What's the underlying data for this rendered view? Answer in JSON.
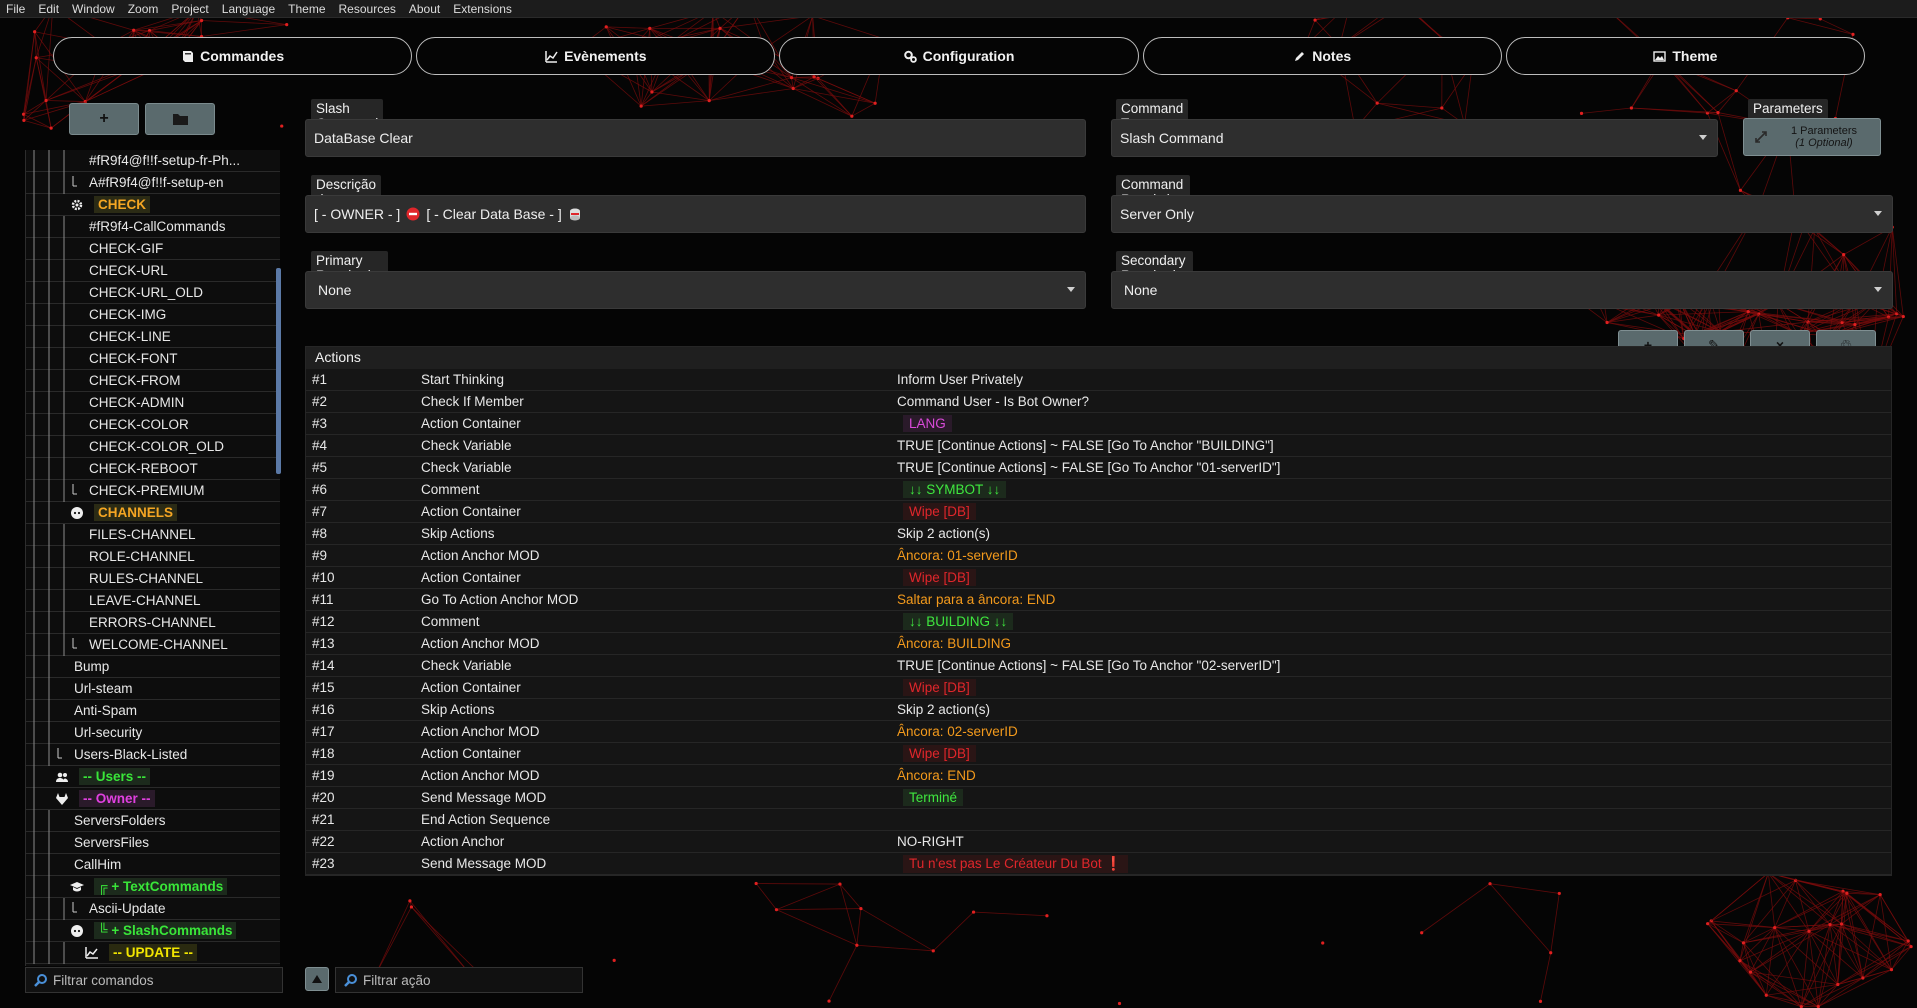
{
  "menu": [
    "File",
    "Edit",
    "Window",
    "Zoom",
    "Project",
    "Language",
    "Theme",
    "Resources",
    "About",
    "Extensions"
  ],
  "tabs": [
    {
      "label": "Commandes",
      "icon": "book-icon"
    },
    {
      "label": "Evènements",
      "icon": "line-chart-icon"
    },
    {
      "label": "Configuration",
      "icon": "gears-icon"
    },
    {
      "label": "Notes",
      "icon": "pencil-icon"
    },
    {
      "label": "Theme",
      "icon": "image-icon"
    }
  ],
  "sidebar": {
    "add_label": "+",
    "filter_placeholder": "Filtrar comandos",
    "items": [
      {
        "text": "#fR9f4@f!!f-setup-fr-Ph...",
        "indent": 3,
        "color": "#e8e8e8"
      },
      {
        "text": "A#fR9f4@f!!f-setup-en",
        "indent": 3,
        "color": "#e8e8e8",
        "last": true
      },
      {
        "text": "CHECK",
        "indent": 2,
        "color": "#f5a623",
        "folder": true,
        "icon": "gear-icon",
        "bg": "#2b2b15"
      },
      {
        "text": "#fR9f4-CallCommands",
        "indent": 3,
        "color": "#e8e8e8"
      },
      {
        "text": "CHECK-GIF",
        "indent": 3,
        "color": "#e8e8e8"
      },
      {
        "text": "CHECK-URL",
        "indent": 3,
        "color": "#e8e8e8"
      },
      {
        "text": "CHECK-URL_OLD",
        "indent": 3,
        "color": "#e8e8e8"
      },
      {
        "text": "CHECK-IMG",
        "indent": 3,
        "color": "#e8e8e8"
      },
      {
        "text": "CHECK-LINE",
        "indent": 3,
        "color": "#e8e8e8"
      },
      {
        "text": "CHECK-FONT",
        "indent": 3,
        "color": "#e8e8e8"
      },
      {
        "text": "CHECK-FROM",
        "indent": 3,
        "color": "#e8e8e8"
      },
      {
        "text": "CHECK-ADMIN",
        "indent": 3,
        "color": "#e8e8e8"
      },
      {
        "text": "CHECK-COLOR",
        "indent": 3,
        "color": "#e8e8e8"
      },
      {
        "text": "CHECK-COLOR_OLD",
        "indent": 3,
        "color": "#e8e8e8"
      },
      {
        "text": "CHECK-REBOOT",
        "indent": 3,
        "color": "#e8e8e8"
      },
      {
        "text": "CHECK-PREMIUM",
        "indent": 3,
        "color": "#e8e8e8",
        "last": true
      },
      {
        "text": "CHANNELS",
        "indent": 2,
        "color": "#f5a623",
        "folder": true,
        "icon": "discord-icon",
        "bg": "#2b2b15"
      },
      {
        "text": "FILES-CHANNEL",
        "indent": 3,
        "color": "#e8e8e8"
      },
      {
        "text": "ROLE-CHANNEL",
        "indent": 3,
        "color": "#e8e8e8"
      },
      {
        "text": "RULES-CHANNEL",
        "indent": 3,
        "color": "#e8e8e8"
      },
      {
        "text": "LEAVE-CHANNEL",
        "indent": 3,
        "color": "#e8e8e8"
      },
      {
        "text": "ERRORS-CHANNEL",
        "indent": 3,
        "color": "#e8e8e8"
      },
      {
        "text": "WELCOME-CHANNEL",
        "indent": 3,
        "color": "#e8e8e8",
        "last": true
      },
      {
        "text": "Bump",
        "indent": 2,
        "color": "#e8e8e8"
      },
      {
        "text": "Url-steam",
        "indent": 2,
        "color": "#e8e8e8"
      },
      {
        "text": "Anti-Spam",
        "indent": 2,
        "color": "#e8e8e8"
      },
      {
        "text": "Url-security",
        "indent": 2,
        "color": "#e8e8e8"
      },
      {
        "text": "Users-Black-Listed",
        "indent": 2,
        "color": "#e8e8e8",
        "last": true
      },
      {
        "text": "-- Users --",
        "indent": 1,
        "color": "#39e639",
        "folder": true,
        "icon": "users-icon",
        "bg": "#1c2a1c"
      },
      {
        "text": "-- Owner --",
        "indent": 1,
        "color": "#e040e0",
        "folder": true,
        "icon": "gitlab-icon",
        "bg": "#2a1a2a"
      },
      {
        "text": "ServersFolders",
        "indent": 2,
        "color": "#e8e8e8"
      },
      {
        "text": "ServersFiles",
        "indent": 2,
        "color": "#e8e8e8"
      },
      {
        "text": "CallHim",
        "indent": 2,
        "color": "#e8e8e8"
      },
      {
        "text": "╔ + TextCommands",
        "indent": 2,
        "color": "#39e639",
        "folder": true,
        "icon": "graduation-cap-icon",
        "bg": "#1c2a1c"
      },
      {
        "text": "Ascii-Update",
        "indent": 3,
        "color": "#e8e8e8",
        "last": true
      },
      {
        "text": "╚ + SlashCommands",
        "indent": 2,
        "color": "#39e639",
        "folder": true,
        "icon": "discord-icon",
        "bg": "#1c2a1c"
      },
      {
        "text": "-- UPDATE --",
        "indent": 3,
        "color": "#f2e600",
        "folder": true,
        "icon": "line-chart-icon",
        "bg": "#2a2a10"
      }
    ]
  },
  "form": {
    "name_label": "Slash Command Name",
    "name_value": "DataBase Clear",
    "type_label": "Command Type",
    "type_value": "Slash Command",
    "params_label": "Parameters",
    "params_line1": "1 Parameters",
    "params_line2": "(1 Optional)",
    "desc_label": "Descrição do Comando",
    "desc_part1": "[ - OWNER - ]",
    "desc_part2": "[ - Clear Data Base - ]",
    "restriction_label": "Command Restriction",
    "restriction_value": "Server Only",
    "primary_label": "Primary Required Permission",
    "primary_value": "None",
    "secondary_label": "Secondary Required Permission",
    "secondary_value": "None"
  },
  "actions": {
    "header": "Actions",
    "filter_placeholder": "Filtrar ação",
    "tools": [
      "+",
      "✎",
      "×",
      "♲"
    ],
    "rows": [
      {
        "num": "#1",
        "name": "Start Thinking",
        "detail": "Inform User Privately",
        "color": "#e8e8e8",
        "badge": false
      },
      {
        "num": "#2",
        "name": "Check If Member",
        "detail": "Command User - Is Bot Owner?",
        "color": "#e8e8e8",
        "badge": false
      },
      {
        "num": "#3",
        "name": "Action Container",
        "detail": "LANG",
        "color": "#d94ad9",
        "badge": true,
        "bbg": "#2a1a2a"
      },
      {
        "num": "#4",
        "name": "Check Variable",
        "detail": "TRUE [Continue Actions] ~ FALSE [Go To Anchor \"BUILDING\"]",
        "color": "#e8e8e8",
        "badge": false
      },
      {
        "num": "#5",
        "name": "Check Variable",
        "detail": "TRUE [Continue Actions] ~ FALSE [Go To Anchor \"01-serverID\"]",
        "color": "#e8e8e8",
        "badge": false
      },
      {
        "num": "#6",
        "name": "Comment",
        "detail": "↓↓ SYMBOT ↓↓",
        "color": "#3fe83f",
        "badge": true,
        "bbg": "#1c2a1c"
      },
      {
        "num": "#7",
        "name": "Action Container",
        "detail": "Wipe [DB]",
        "color": "#e0262b",
        "badge": true,
        "bbg": "#2a1515"
      },
      {
        "num": "#8",
        "name": "Skip Actions",
        "detail": "Skip 2 action(s)",
        "color": "#e8e8e8",
        "badge": false
      },
      {
        "num": "#9",
        "name": "Action Anchor MOD",
        "detail": "Âncora: 01-serverID",
        "color": "#f39a1c",
        "badge": false
      },
      {
        "num": "#10",
        "name": "Action Container",
        "detail": "Wipe [DB]",
        "color": "#e0262b",
        "badge": true,
        "bbg": "#2a1515"
      },
      {
        "num": "#11",
        "name": "Go To Action Anchor MOD",
        "detail": "Saltar para a âncora: END",
        "color": "#f39a1c",
        "badge": false
      },
      {
        "num": "#12",
        "name": "Comment",
        "detail": "↓↓ BUILDING ↓↓",
        "color": "#3fe83f",
        "badge": true,
        "bbg": "#1c2a1c"
      },
      {
        "num": "#13",
        "name": "Action Anchor MOD",
        "detail": "Âncora: BUILDING",
        "color": "#f39a1c",
        "badge": false
      },
      {
        "num": "#14",
        "name": "Check Variable",
        "detail": "TRUE [Continue Actions] ~ FALSE [Go To Anchor \"02-serverID\"]",
        "color": "#e8e8e8",
        "badge": false
      },
      {
        "num": "#15",
        "name": "Action Container",
        "detail": "Wipe [DB]",
        "color": "#e0262b",
        "badge": true,
        "bbg": "#2a1515"
      },
      {
        "num": "#16",
        "name": "Skip Actions",
        "detail": "Skip 2 action(s)",
        "color": "#e8e8e8",
        "badge": false
      },
      {
        "num": "#17",
        "name": "Action Anchor MOD",
        "detail": "Âncora: 02-serverID",
        "color": "#f39a1c",
        "badge": false
      },
      {
        "num": "#18",
        "name": "Action Container",
        "detail": "Wipe [DB]",
        "color": "#e0262b",
        "badge": true,
        "bbg": "#2a1515"
      },
      {
        "num": "#19",
        "name": "Action Anchor MOD",
        "detail": "Âncora: END",
        "color": "#f39a1c",
        "badge": false
      },
      {
        "num": "#20",
        "name": "Send Message MOD",
        "detail": "Terminé",
        "color": "#3fe83f",
        "badge": true,
        "bbg": "#1c2a1c"
      },
      {
        "num": "#21",
        "name": "End Action Sequence",
        "detail": "",
        "color": "#e8e8e8",
        "badge": false
      },
      {
        "num": "#22",
        "name": "Action Anchor",
        "detail": "NO-RIGHT",
        "color": "#e8e8e8",
        "badge": false
      },
      {
        "num": "#23",
        "name": "Send Message MOD",
        "detail": "Tu n'est pas Le Créateur Du Bot ❗",
        "color": "#e0262b",
        "badge": true,
        "bbg": "#2a1515"
      }
    ]
  }
}
